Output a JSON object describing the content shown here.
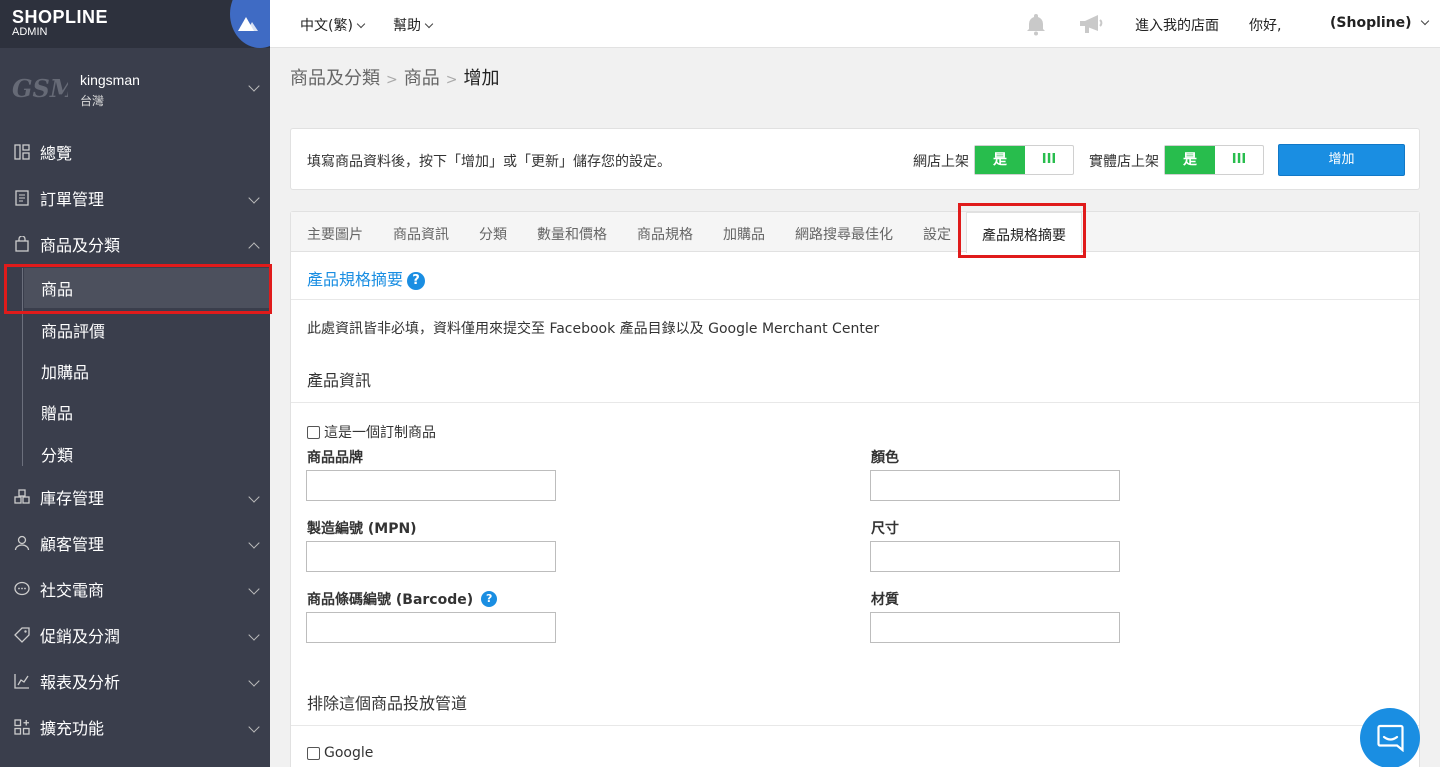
{
  "brand": {
    "name": "SHOPLINE",
    "sub": "ADMIN"
  },
  "store": {
    "logo": "GSM",
    "name": "kingsman",
    "region": "台灣"
  },
  "nav": {
    "overview": "總覽",
    "orders": "訂單管理",
    "products_category": "商品及分類",
    "sub_items": [
      "商品",
      "商品評價",
      "加購品",
      "贈品",
      "分類"
    ],
    "inventory": "庫存管理",
    "customers": "顧客管理",
    "social": "社交電商",
    "promotions": "促銷及分潤",
    "reports": "報表及分析",
    "apps": "擴充功能"
  },
  "topbar": {
    "language": "中文(繁)",
    "help": "幫助",
    "visit_store": "進入我的店面",
    "greeting": "你好,",
    "account": "(Shopline)"
  },
  "breadcrumb": {
    "level1": "商品及分類",
    "level2": "商品",
    "current": "增加"
  },
  "info_bar": {
    "text": "填寫商品資料後，按下「增加」或「更新」儲存您的設定。",
    "online_label": "網店上架",
    "retail_label": "實體店上架",
    "on": "是",
    "off": "III",
    "add_button": "增加"
  },
  "tabs": [
    "主要圖片",
    "商品資訊",
    "分類",
    "數量和價格",
    "商品規格",
    "加購品",
    "網路搜尋最佳化",
    "設定",
    "產品規格摘要"
  ],
  "section": {
    "title": "產品規格摘要",
    "help": "?",
    "description": "此處資訊皆非必填，資料僅用來提交至 Facebook 產品目錄以及 Google Merchant Center",
    "product_info": "產品資訊",
    "custom_checkbox": "這是一個訂制商品",
    "fields": {
      "brand": "商品品牌",
      "mpn": "製造編號 (MPN)",
      "barcode": "商品條碼編號 (Barcode)",
      "color": "顏色",
      "size": "尺寸",
      "material": "材質"
    },
    "exclude_title": "排除這個商品投放管道",
    "google_checkbox": "Google"
  }
}
